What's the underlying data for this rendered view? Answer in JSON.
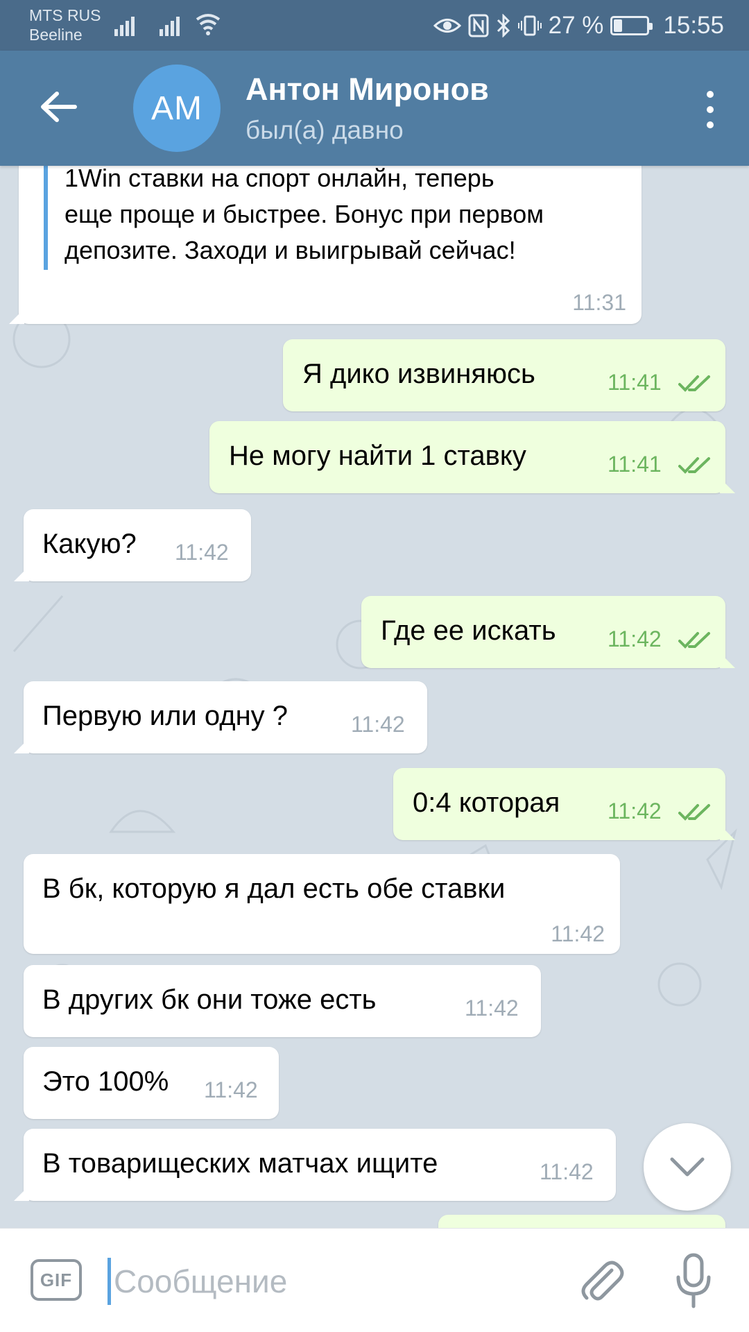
{
  "status_bar": {
    "carrier_1": "MTS RUS",
    "carrier_2": "Beeline",
    "battery": "27 %",
    "time": "15:55"
  },
  "header": {
    "avatar_initials": "АМ",
    "title": "Антон Миронов",
    "subtitle": "был(а) давно"
  },
  "messages": [
    {
      "dir": "in",
      "text": "1Win ставки на спорт онлайн, теперь еще проще и быстрее. Бонус при первом депозите. Заходи и выигрывай сейчас!",
      "line_1": "1Win ставки на спорт онлайн, теперь",
      "line_2": "еще проще и быстрее. Бонус при первом",
      "line_3": "депозите. Заходи и выигрывай сейчас!",
      "time": "11:31"
    },
    {
      "dir": "out",
      "text": "Я дико извиняюсь",
      "time": "11:41",
      "read": true
    },
    {
      "dir": "out",
      "text": "Не могу найти 1 ставку",
      "time": "11:41",
      "read": true
    },
    {
      "dir": "in",
      "text": "Какую?",
      "time": "11:42"
    },
    {
      "dir": "out",
      "text": "Где ее искать",
      "time": "11:42",
      "read": true
    },
    {
      "dir": "in",
      "text": "Первую или одну ?",
      "time": "11:42"
    },
    {
      "dir": "out",
      "text": "0:4 которая",
      "time": "11:42",
      "read": true
    },
    {
      "dir": "in",
      "text": "В бк, которую я дал есть обе ставки",
      "time": "11:42"
    },
    {
      "dir": "in",
      "text": "В других бк они тоже есть",
      "time": "11:42"
    },
    {
      "dir": "in",
      "text": "Это 100%",
      "time": "11:42"
    },
    {
      "dir": "in",
      "text": "В товарищеских матчах ищите",
      "time": "11:42"
    }
  ],
  "composer": {
    "gif_label": "GIF",
    "placeholder": "Сообщение"
  },
  "icons": {
    "back": "arrow-left-icon",
    "more": "more-vertical-icon",
    "scroll_down": "chevron-down-icon",
    "attach": "paperclip-icon",
    "mic": "microphone-icon",
    "read_receipt": "double-check-icon"
  },
  "colors": {
    "header": "#517da2",
    "status_bar": "#4a6b8a",
    "avatar": "#5aa3e0",
    "chat_bg": "#d4dde5",
    "incoming_bubble": "#ffffff",
    "outgoing_bubble": "#efffde",
    "outgoing_time": "#6cb55f"
  }
}
